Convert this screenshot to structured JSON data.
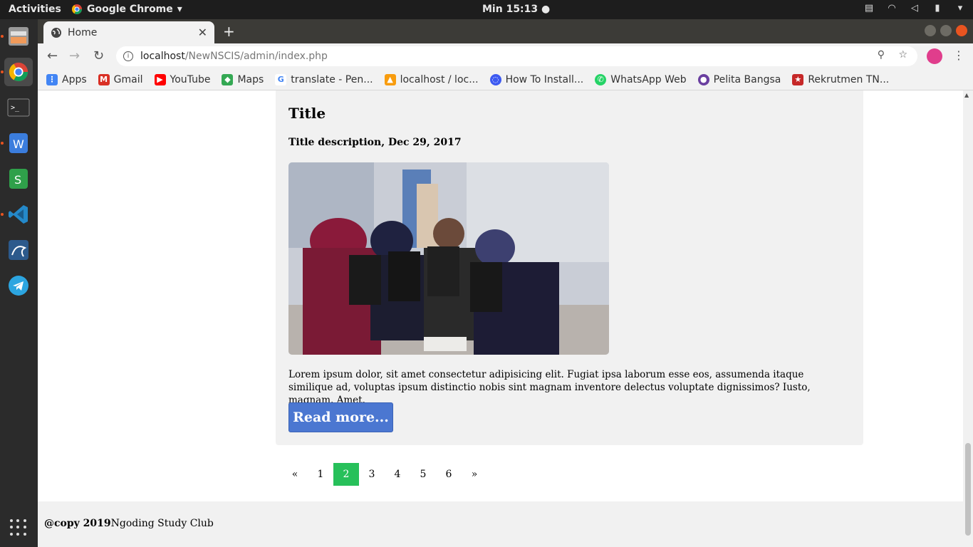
{
  "system_bar": {
    "activities": "Activities",
    "app_name": "Google Chrome",
    "clock": "Min 15:13 ●"
  },
  "browser": {
    "tab_title": "Home",
    "url_host": "localhost",
    "url_path": "/NewNSCIS/admin/index.php",
    "bookmarks": [
      {
        "label": "Apps",
        "icon": "apps-grid-icon",
        "color": "#4285f4"
      },
      {
        "label": "Gmail",
        "icon": "gmail-icon",
        "color": "#d93025"
      },
      {
        "label": "YouTube",
        "icon": "youtube-icon",
        "color": "#ff0000"
      },
      {
        "label": "Maps",
        "icon": "maps-icon",
        "color": "#34a853"
      },
      {
        "label": "translate - Pen...",
        "icon": "google-icon",
        "color": "#4285f4"
      },
      {
        "label": "localhost / loc...",
        "icon": "phpmyadmin-icon",
        "color": "#f89c0e"
      },
      {
        "label": "How To Install...",
        "icon": "site-icon",
        "color": "#3d5af1"
      },
      {
        "label": "WhatsApp Web",
        "icon": "whatsapp-icon",
        "color": "#25d366"
      },
      {
        "label": "Pelita Bangsa",
        "icon": "pelita-bangsa-icon",
        "color": "#6a3fa0"
      },
      {
        "label": "Rekrutmen TN...",
        "icon": "tni-icon",
        "color": "#c62828"
      }
    ]
  },
  "post": {
    "title": "Title",
    "subtitle": "Title description, Dec 29, 2017",
    "body": "Lorem ipsum dolor, sit amet consectetur adipisicing elit. Fugiat ipsa laborum esse eos, assumenda itaque similique ad, voluptas ipsum distinctio nobis sint magnam inventore delectus voluptate dignissimos? Iusto, magnam. Amet.",
    "read_more": "Read more..."
  },
  "pagination": {
    "prev": "«",
    "pages": [
      "1",
      "2",
      "3",
      "4",
      "5",
      "6"
    ],
    "active": "2",
    "next": "»",
    "active_color": "#27c05a"
  },
  "footer": {
    "copy": "@copy 2019",
    "club": "Ngoding Study Club"
  }
}
